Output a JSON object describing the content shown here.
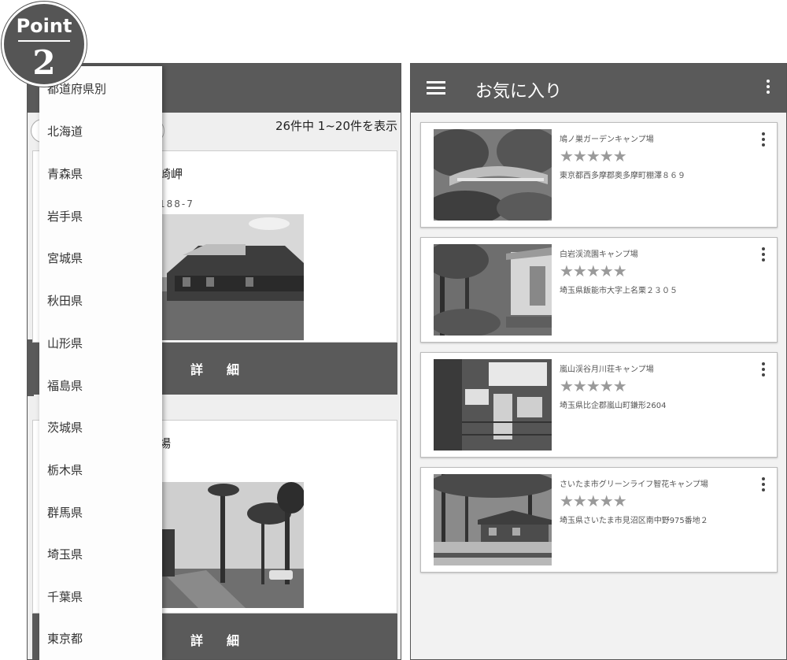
{
  "badge": {
    "label": "Point",
    "number": "2"
  },
  "left_screen": {
    "result_count": "26件中 1~20件を表示",
    "cards": [
      {
        "title_fragment": "崎岬",
        "address_fragment": "188-7",
        "detail_label": "詳細"
      },
      {
        "title_fragment": "場",
        "detail_label": "詳細"
      }
    ],
    "drawer": {
      "items": [
        "都道府県別",
        "北海道",
        "青森県",
        "岩手県",
        "宮城県",
        "秋田県",
        "山形県",
        "福島県",
        "茨城県",
        "栃木県",
        "群馬県",
        "埼玉県",
        "千葉県",
        "東京都"
      ]
    }
  },
  "right_screen": {
    "title": "お気に入り",
    "menu_icon": "hamburger-icon",
    "more_icon": "more-vert-icon",
    "favorites": [
      {
        "name": "鳩ノ巣ガーデンキャンプ場",
        "stars": "★★★★★",
        "address": "東京都西多摩郡奥多摩町棚澤８６９"
      },
      {
        "name": "白岩渓流園キャンプ場",
        "stars": "★★★★★",
        "address": "埼玉県飯能市大字上名栗２３０５"
      },
      {
        "name": "嵐山渓谷月川荘キャンプ場",
        "stars": "★★★★★",
        "address": "埼玉県比企郡嵐山町鎌形2604"
      },
      {
        "name": "さいたま市グリーンライフ智花キャンプ場",
        "stars": "★★★★★",
        "address": "埼玉県さいたま市見沼区南中野975番地２"
      }
    ]
  },
  "colors": {
    "appbar": "#5a5a5a",
    "card_bg": "#ffffff",
    "screen_bg": "#efefef",
    "star": "#9a9a9a"
  }
}
